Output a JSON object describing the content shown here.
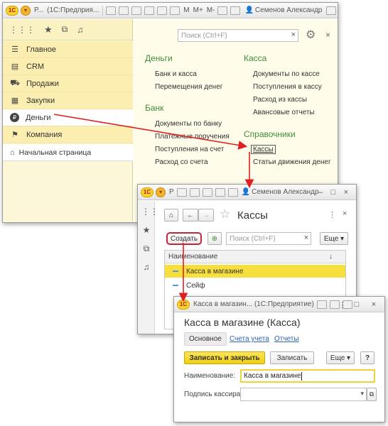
{
  "main_window": {
    "title_app": "Р...",
    "title_prog": "(1С:Предприя...",
    "title_m": "M",
    "title_mplus": "M+",
    "title_mminus": "M-",
    "title_user": "Семенов Александр",
    "search_placeholder": "Поиск (Ctrl+F)",
    "sidebar": [
      {
        "label": "Главное",
        "icon": "menu-lines-icon"
      },
      {
        "label": "CRM",
        "icon": "crm-card-icon"
      },
      {
        "label": "Продажи",
        "icon": "cart-icon"
      },
      {
        "label": "Закупки",
        "icon": "box-icon"
      },
      {
        "label": "Деньги",
        "icon": "ruble-coin-icon"
      },
      {
        "label": "Компания",
        "icon": "flag-icon"
      }
    ],
    "start_page": "Начальная страница",
    "sections": {
      "money": {
        "title": "Деньги",
        "items": [
          "Банк и касса",
          "Перемещения денег"
        ]
      },
      "bank": {
        "title": "Банк",
        "items": [
          "Документы по банку",
          "Платежные поручения",
          "Поступления на счет",
          "Расход со счета"
        ]
      },
      "kassa": {
        "title": "Касса",
        "items": [
          "Документы по кассе",
          "Поступления в кассу",
          "Расход из кассы",
          "Авансовые отчеты"
        ]
      },
      "refs": {
        "title": "Справочники",
        "items": [
          "Кассы",
          "Статьи движения денег"
        ]
      }
    }
  },
  "kassy_window": {
    "title_app": "Р",
    "title_user": "Семенов Александр",
    "form_title": "Кассы",
    "create_label": "Создать",
    "search_placeholder": "Поиск (Ctrl+F)",
    "more_label": "Еще",
    "column_header": "Наименование",
    "sort_mark": "↓",
    "rows": [
      "Касса в магазине",
      "Сейф"
    ],
    "accent": "#f7df3e"
  },
  "item_window": {
    "title": "Касса в магазин... (1С:Предприятие)",
    "form_title": "Касса в магазине (Касса)",
    "tabs": [
      "Основное",
      "Счета учета",
      "Отчеты"
    ],
    "save_close_label": "Записать и закрыть",
    "save_label": "Записать",
    "more_label": "Еще",
    "help_label": "?",
    "name_label": "Наименование:",
    "name_value": "Касса в магазине",
    "cashier_label": "Подпись кассира:",
    "cashier_value": ""
  },
  "colors": {
    "arrow": "#e02020",
    "section_title": "#3d8f3a",
    "sidebar_bg": "#fbeeb0",
    "yellow_button": "#f2cf0f"
  }
}
